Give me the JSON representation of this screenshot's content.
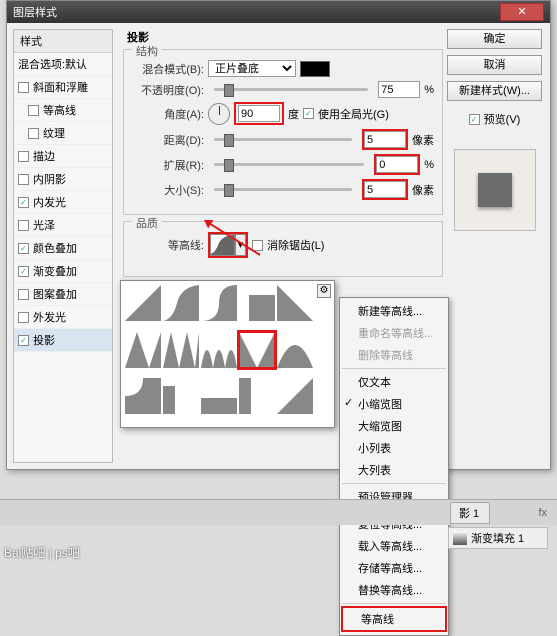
{
  "title": "图层样式",
  "left": {
    "header": "样式",
    "blend_defaults": "混合选项:默认",
    "items": [
      {
        "label": "斜面和浮雕",
        "checked": false
      },
      {
        "label": "等高线",
        "checked": false,
        "indent": true
      },
      {
        "label": "纹理",
        "checked": false,
        "indent": true
      },
      {
        "label": "描边",
        "checked": false
      },
      {
        "label": "内阴影",
        "checked": false
      },
      {
        "label": "内发光",
        "checked": true
      },
      {
        "label": "光泽",
        "checked": false
      },
      {
        "label": "颜色叠加",
        "checked": true
      },
      {
        "label": "渐变叠加",
        "checked": true
      },
      {
        "label": "图案叠加",
        "checked": false
      },
      {
        "label": "外发光",
        "checked": false
      },
      {
        "label": "投影",
        "checked": true,
        "selected": true
      }
    ]
  },
  "panel_title": "投影",
  "structure": {
    "legend": "结构",
    "blendmode_label": "混合模式(B):",
    "blendmode_value": "正片叠底",
    "opacity_label": "不透明度(O):",
    "opacity_value": "75",
    "pct": "%",
    "angle_label": "角度(A):",
    "angle_value": "90",
    "deg": "度",
    "global_label": "使用全局光(G)",
    "distance_label": "距离(D):",
    "distance_value": "5",
    "px": "像素",
    "spread_label": "扩展(R):",
    "spread_value": "0",
    "size_label": "大小(S):",
    "size_value": "5"
  },
  "quality": {
    "legend": "品质",
    "contour_label": "等高线:",
    "antialias_label": "消除锯齿(L)"
  },
  "right": {
    "ok": "确定",
    "cancel": "取消",
    "newstyle": "新建样式(W)...",
    "preview": "预览(V)"
  },
  "ctx": {
    "new": "新建等高线...",
    "rename": "重命名等高线...",
    "delete": "删除等高线",
    "textonly": "仅文本",
    "smallthumb": "小缩览图",
    "largethumb": "大缩览图",
    "smalllist": "小列表",
    "largelist": "大列表",
    "preset": "预设管理器...",
    "reset": "复位等高线...",
    "load": "载入等高线...",
    "save": "存储等高线...",
    "replace": "替换等高线...",
    "contours": "等高线"
  },
  "bottom": {
    "tab": "影 1",
    "fx": "fx",
    "layer": "渐变填充 1"
  },
  "watermark": "Bai贴吧 | ps吧"
}
